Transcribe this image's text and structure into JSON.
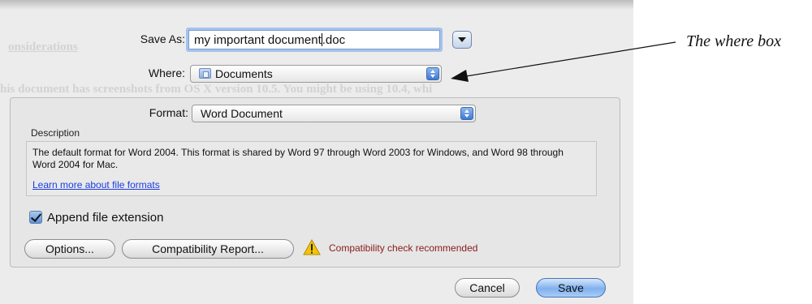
{
  "dialog": {
    "save_as_label": "Save As:",
    "filename_before_caret": "my important document",
    "filename_after_caret": ".doc",
    "where_label": "Where:",
    "where_value": "Documents",
    "format_label": "Format:",
    "format_value": "Word Document",
    "description_title": "Description",
    "description_text": "The default format for Word 2004. This format is shared by Word 97 through Word 2003 for Windows, and Word 98 through Word 2004 for Mac.",
    "description_link": "Learn more about file formats",
    "append_extension_label": "Append file extension",
    "append_extension_checked": true,
    "options_button": "Options...",
    "compat_report_button": "Compatibility Report...",
    "compat_warning": "Compatibility check recommended",
    "cancel_button": "Cancel",
    "save_button": "Save"
  },
  "background_document": {
    "heading": "onsiderations",
    "line": "his document has screenshots from OS X version 10.5. You might be using 10.4, whi"
  },
  "annotation": {
    "text": "The where box"
  },
  "colors": {
    "sheet_bg": "#ececec",
    "focus_ring": "#a4c3ef",
    "link": "#1a3de0",
    "warning_text": "#8b1a1a",
    "default_button": "#7fb0ef"
  },
  "icons": [
    "chevron-down-icon",
    "folder-icon",
    "stepper-icon",
    "checkmark-icon",
    "warning-icon",
    "arrow-icon"
  ]
}
